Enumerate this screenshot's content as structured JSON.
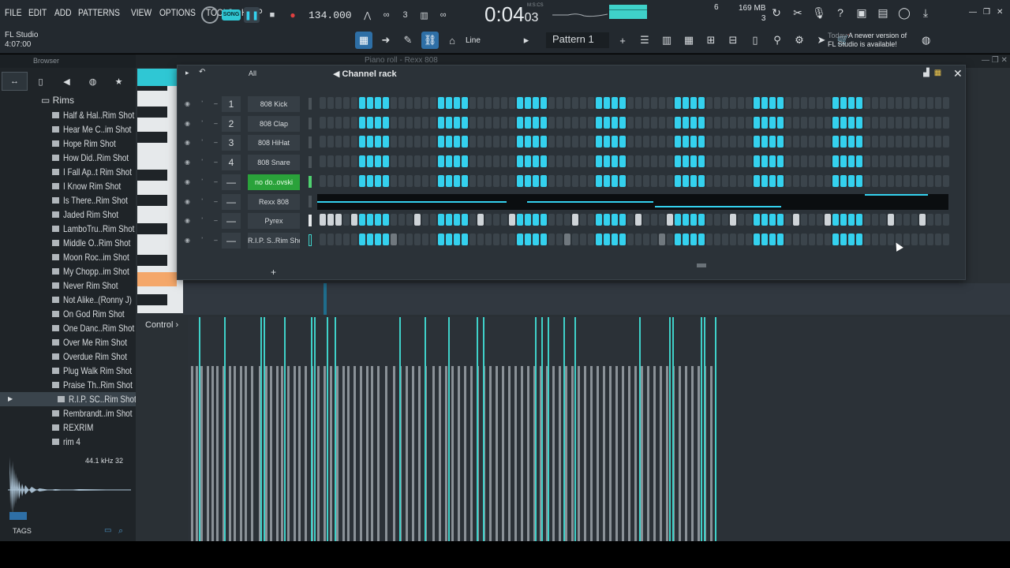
{
  "menu": [
    "FILE",
    "EDIT",
    "ADD",
    "PATTERNS",
    "VIEW",
    "OPTIONS",
    "TOOLS",
    "HELP"
  ],
  "app": {
    "name": "FL Studio",
    "time": "4:07:00"
  },
  "transport": {
    "song_label": "SONG",
    "tempo": "134.000",
    "time_main": "0:04",
    "time_sub": "03",
    "misc_label": "M:S:CS"
  },
  "status": {
    "memory": "169 MB",
    "mem_sub": "3",
    "polyphony": "6"
  },
  "toolbar": {
    "snap_mode": "Line",
    "pattern": "Pattern 1"
  },
  "news": {
    "day": "Today",
    "text1": "A newer version of",
    "text2": "FL Studio is available!"
  },
  "browser": {
    "title": "Browser",
    "folder": "Rims",
    "items": [
      "Half & Hal..Rim Shot",
      "Hear Me C..im Shot",
      "Hope Rim Shot",
      "How Did..Rim Shot",
      "I Fall Ap..t Rim Shot",
      "I Know Rim Shot",
      "Is There..Rim Shot",
      "Jaded Rim Shot",
      "LamboTru..Rim Shot",
      "Middle O..Rim Shot",
      "Moon Roc..im Shot",
      "My Chopp..im Shot",
      "Never Rim Shot",
      "Not Alike..(Ronny J)",
      "On God Rim Shot",
      "One Danc..Rim Shot",
      "Over Me Rim Shot",
      "Overdue Rim Shot",
      "Plug Walk Rim Shot",
      "Praise Th..Rim Shot",
      "R.I.P. SC..Rim Shot",
      "Rembrandt..im Shot",
      "REXRIM",
      "rim 4"
    ],
    "selected_index": 20,
    "wave_info": "44.1 kHz 32",
    "tags_label": "TAGS"
  },
  "pianoroll": {
    "title": "Piano roll - Rexx 808",
    "control_label": "Control"
  },
  "channel_rack": {
    "title": "Channel rack",
    "filter": "All",
    "add_label": "+",
    "channels": [
      {
        "num": "1",
        "name": "808 Kick",
        "type": "steps"
      },
      {
        "num": "2",
        "name": "808 Clap",
        "type": "steps"
      },
      {
        "num": "3",
        "name": "808 HiHat",
        "type": "steps"
      },
      {
        "num": "4",
        "name": "808 Snare",
        "type": "steps"
      },
      {
        "num": "—",
        "name": "no do..ovski",
        "type": "steps",
        "highlight": true
      },
      {
        "num": "—",
        "name": "Rexx 808",
        "type": "piano"
      },
      {
        "num": "—",
        "name": "Pyrex",
        "type": "steps_mixed"
      },
      {
        "num": "—",
        "name": "R.I.P. S..Rim Shot",
        "type": "steps_rim"
      }
    ]
  },
  "colors": {
    "accent": "#34d1ee",
    "green": "#2aa23a",
    "orange": "#f4a76a"
  },
  "icons": [
    "tempo-circle-icon",
    "pause-icon",
    "stop-icon",
    "record-icon",
    "metronome-icon",
    "close-icon",
    "add-icon"
  ]
}
